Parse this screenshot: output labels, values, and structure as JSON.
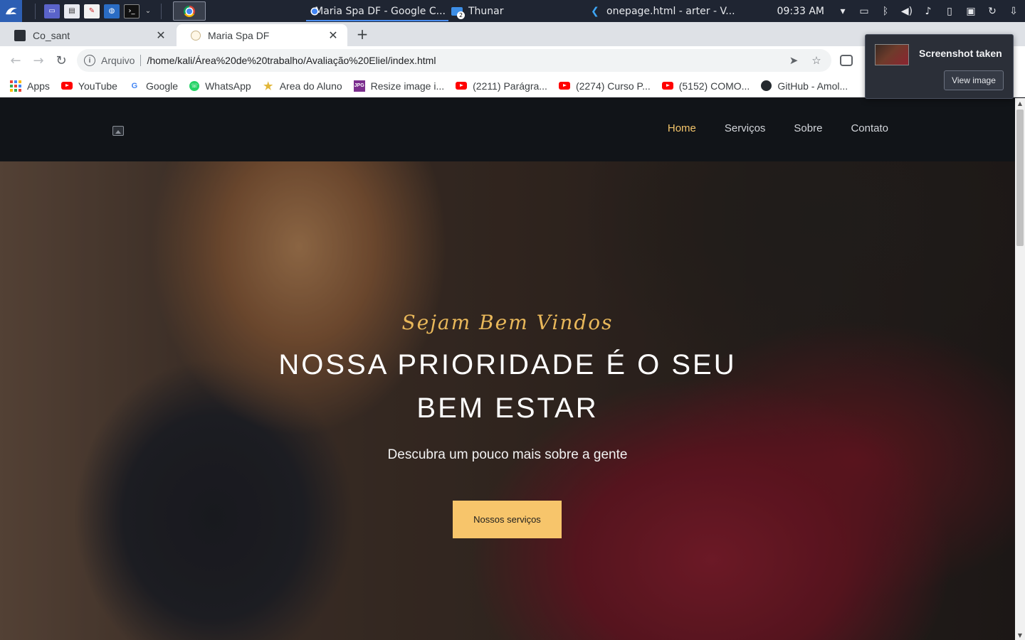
{
  "taskbar": {
    "windows": [
      {
        "label": "Maria Spa DF - Google C...",
        "icon": "chrome-icon",
        "active": true
      },
      {
        "label": "Thunar",
        "icon": "folder-icon",
        "badge": "2"
      },
      {
        "label": "onepage.html - arter - V...",
        "icon": "vscode-icon"
      }
    ],
    "clock": "09:33 AM"
  },
  "browser": {
    "tabs": [
      {
        "title": "Co_sant",
        "active": false
      },
      {
        "title": "Maria Spa DF",
        "active": true
      }
    ],
    "omnibox": {
      "scheme_label": "Arquivo",
      "url": "/home/kali/Área%20de%20trabalho/Avaliação%20Eliel/index.html"
    },
    "bookmarks": [
      {
        "label": "Apps",
        "icon": "apps-icon"
      },
      {
        "label": "YouTube",
        "icon": "youtube-icon"
      },
      {
        "label": "Google",
        "icon": "google-icon"
      },
      {
        "label": "WhatsApp",
        "icon": "whatsapp-icon"
      },
      {
        "label": "Area do Aluno",
        "icon": "star-icon"
      },
      {
        "label": "Resize image i...",
        "icon": "jpg-icon"
      },
      {
        "label": "(2211) Parágra...",
        "icon": "youtube-icon"
      },
      {
        "label": "(2274) Curso P...",
        "icon": "youtube-icon"
      },
      {
        "label": "(5152) COMO...",
        "icon": "youtube-icon"
      },
      {
        "label": "GitHub - Amol...",
        "icon": "github-icon"
      }
    ]
  },
  "notification": {
    "title": "Screenshot taken",
    "button": "View image"
  },
  "site": {
    "nav": {
      "links": [
        "Home",
        "Serviços",
        "Sobre",
        "Contato"
      ],
      "active": "Home"
    },
    "hero": {
      "kicker": "Sejam Bem Vindos",
      "title_line1": "NOSSA PRIORIDADE É O SEU",
      "title_line2": "BEM ESTAR",
      "subtitle": "Descubra um pouco mais sobre a gente",
      "button": "Nossos serviços"
    }
  },
  "colors": {
    "accent": "#f7c56b",
    "nav_bg": "#111418",
    "taskbar_bg": "#1f2532"
  }
}
